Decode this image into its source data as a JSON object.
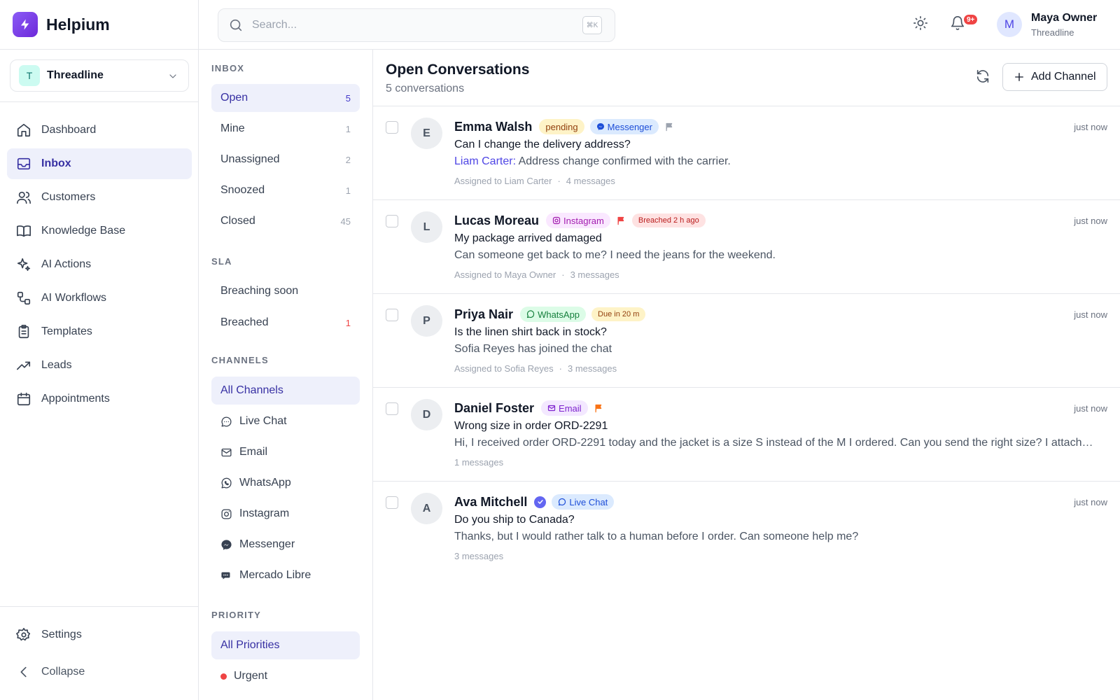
{
  "app": {
    "name": "Helpium"
  },
  "search": {
    "placeholder": "Search...",
    "shortcut": "⌘K"
  },
  "header": {
    "notification_count": "9+",
    "avatar_initial": "M",
    "user_name": "Maya Owner",
    "user_org": "Threadline"
  },
  "org": {
    "initial": "T",
    "name": "Threadline"
  },
  "sidebar": {
    "items": [
      {
        "label": "Dashboard",
        "icon": "home-icon"
      },
      {
        "label": "Inbox",
        "icon": "inbox-icon",
        "active": true
      },
      {
        "label": "Customers",
        "icon": "users-icon"
      },
      {
        "label": "Knowledge Base",
        "icon": "book-icon"
      },
      {
        "label": "AI Actions",
        "icon": "sparkles-icon"
      },
      {
        "label": "AI Workflows",
        "icon": "workflow-icon"
      },
      {
        "label": "Templates",
        "icon": "clipboard-icon"
      },
      {
        "label": "Leads",
        "icon": "trending-up-icon"
      },
      {
        "label": "Appointments",
        "icon": "calendar-icon"
      }
    ],
    "settings_label": "Settings",
    "collapse_label": "Collapse"
  },
  "filters": {
    "inbox_title": "INBOX",
    "inbox": [
      {
        "label": "Open",
        "count": "5",
        "active": true
      },
      {
        "label": "Mine",
        "count": "1"
      },
      {
        "label": "Unassigned",
        "count": "2"
      },
      {
        "label": "Snoozed",
        "count": "1"
      },
      {
        "label": "Closed",
        "count": "45"
      }
    ],
    "sla_title": "SLA",
    "sla": [
      {
        "label": "Breaching soon",
        "count": ""
      },
      {
        "label": "Breached",
        "count": "1"
      }
    ],
    "channels_title": "CHANNELS",
    "channels": [
      {
        "label": "All Channels",
        "active": true
      },
      {
        "label": "Live Chat",
        "icon": "chat-bubble-icon"
      },
      {
        "label": "Email",
        "icon": "mail-icon"
      },
      {
        "label": "WhatsApp",
        "icon": "whatsapp-icon"
      },
      {
        "label": "Instagram",
        "icon": "instagram-icon"
      },
      {
        "label": "Messenger",
        "icon": "messenger-icon"
      },
      {
        "label": "Mercado Libre",
        "icon": "speech-bubbles-icon"
      }
    ],
    "priority_title": "PRIORITY",
    "priority": [
      {
        "label": "All Priorities",
        "active": true
      },
      {
        "label": "Urgent",
        "dot_color": "#ef4444"
      }
    ]
  },
  "main": {
    "title": "Open Conversations",
    "subtitle": "5 conversations",
    "add_button_label": "Add Channel"
  },
  "conversations": [
    {
      "initial": "E",
      "name": "Emma Walsh",
      "status": "pending",
      "channel": "Messenger",
      "flag_color": "#9ca3af",
      "time": "just now",
      "subject": "Can I change the delivery address?",
      "preview_author": "Liam Carter:",
      "preview": " Address change confirmed with the carrier.",
      "assigned": "Assigned to Liam Carter",
      "messages": "4 messages"
    },
    {
      "initial": "L",
      "name": "Lucas Moreau",
      "channel": "Instagram",
      "flag_color": "#ef4444",
      "sla": "Breached 2 h ago",
      "time": "just now",
      "subject": "My package arrived damaged",
      "preview": "Can someone get back to me? I need the jeans for the weekend.",
      "assigned": "Assigned to Maya Owner",
      "messages": "3 messages"
    },
    {
      "initial": "P",
      "name": "Priya Nair",
      "channel": "WhatsApp",
      "sla": "Due in 20 m",
      "time": "just now",
      "subject": "Is the linen shirt back in stock?",
      "preview": "Sofia Reyes has joined the chat",
      "assigned": "Assigned to Sofia Reyes",
      "messages": "3 messages"
    },
    {
      "initial": "D",
      "name": "Daniel Foster",
      "channel": "Email",
      "flag_color": "#f97316",
      "time": "just now",
      "subject": "Wrong size in order ORD-2291",
      "preview": "Hi, I received order ORD-2291 today and the jacket is a size S instead of the M I ordered. Can you send the right size? I attached a photo of the label.",
      "messages": "1 messages"
    },
    {
      "initial": "A",
      "name": "Ava Mitchell",
      "verified": true,
      "channel": "Live Chat",
      "time": "just now",
      "subject": "Do you ship to Canada?",
      "preview": "Thanks, but I would rather talk to a human before I order. Can someone help me?",
      "messages": "3 messages"
    }
  ],
  "colors": {
    "accent": "#4f46e5",
    "active_bg": "#eef0fb",
    "urgent": "#ef4444"
  }
}
